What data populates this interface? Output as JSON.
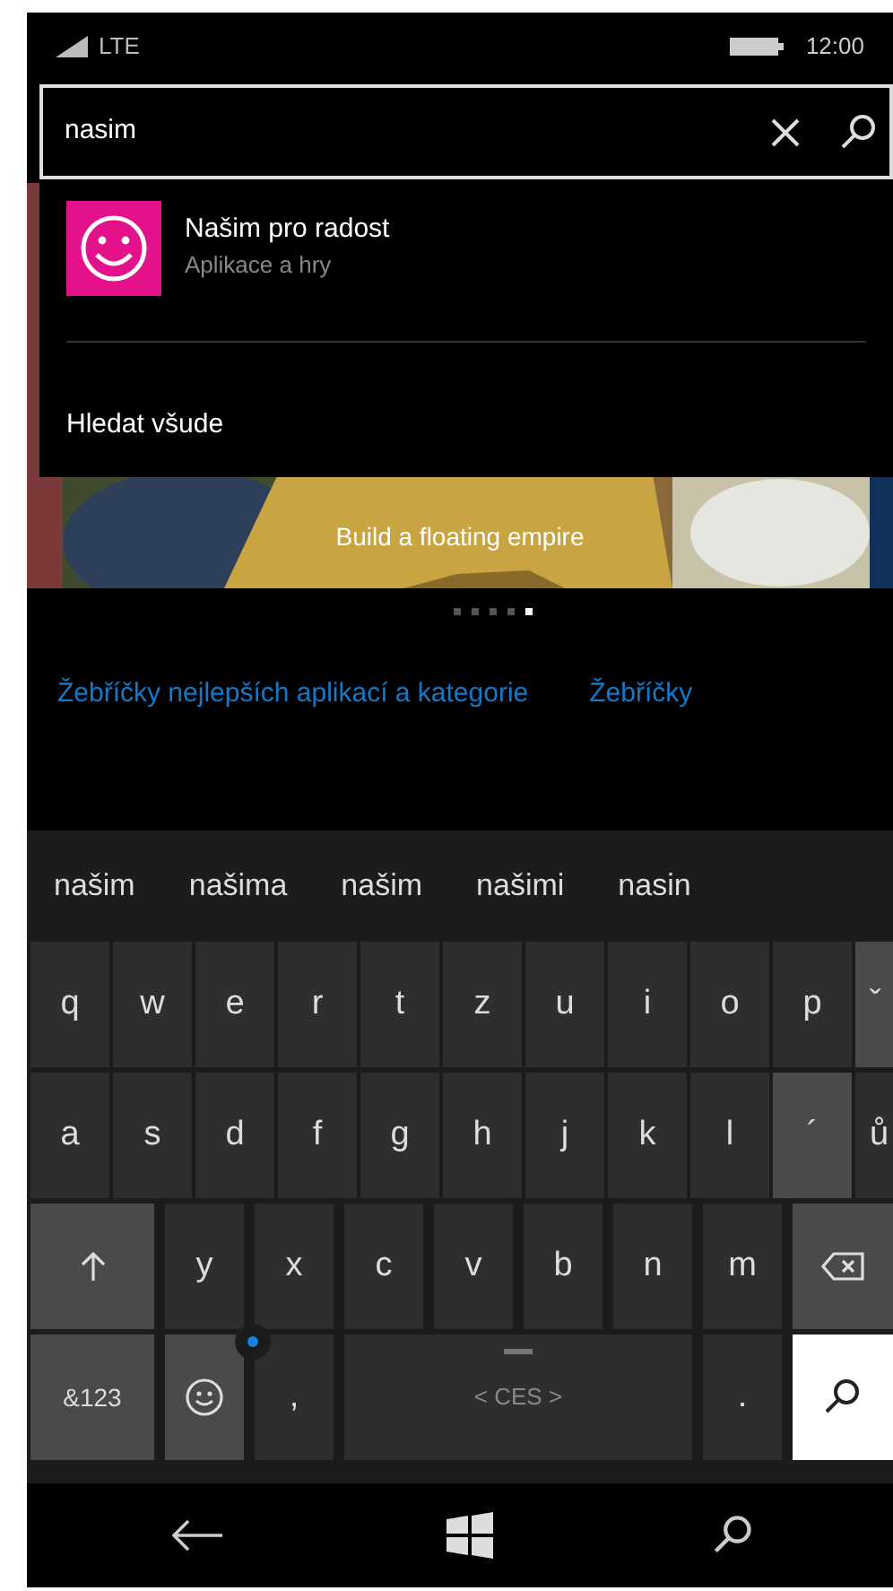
{
  "status_bar": {
    "network": "LTE",
    "time": "12:00"
  },
  "search": {
    "value": "nasim"
  },
  "suggestions": [
    {
      "title": "Našim pro radost",
      "subtitle": "Aplikace a hry"
    }
  ],
  "search_everywhere": "Hledat všude",
  "banner": {
    "caption": "Build a floating empire"
  },
  "pager": [
    {
      "selected": false
    },
    {
      "selected": false
    },
    {
      "selected": false
    },
    {
      "selected": false
    },
    {
      "selected": true
    }
  ],
  "links": [
    "Žebříčky nejlepších aplikací a kategorie",
    "Žebříčky"
  ],
  "keyboard": {
    "predictions": [
      "našim",
      "našima",
      "našim",
      "našimi",
      "nasin"
    ],
    "rows": [
      {
        "keys": [
          {
            "kind": "letter",
            "label": "q"
          },
          {
            "kind": "letter",
            "label": "w"
          },
          {
            "kind": "letter",
            "label": "e"
          },
          {
            "kind": "letter",
            "label": "r"
          },
          {
            "kind": "letter",
            "label": "t"
          },
          {
            "kind": "letter",
            "label": "z"
          },
          {
            "kind": "letter",
            "label": "u"
          },
          {
            "kind": "letter",
            "label": "i"
          },
          {
            "kind": "letter",
            "label": "o"
          },
          {
            "kind": "letter",
            "label": "p"
          },
          {
            "kind": "accent",
            "label": "ˇ"
          }
        ]
      },
      {
        "keys": [
          {
            "kind": "letter",
            "label": "a"
          },
          {
            "kind": "letter",
            "label": "s"
          },
          {
            "kind": "letter",
            "label": "d"
          },
          {
            "kind": "letter",
            "label": "f"
          },
          {
            "kind": "letter",
            "label": "g"
          },
          {
            "kind": "letter",
            "label": "h"
          },
          {
            "kind": "letter",
            "label": "j"
          },
          {
            "kind": "letter",
            "label": "k"
          },
          {
            "kind": "letter",
            "label": "l"
          },
          {
            "kind": "accent",
            "label": "´"
          },
          {
            "kind": "letter",
            "label": "ů"
          }
        ]
      },
      {
        "keys": [
          {
            "kind": "shift"
          },
          {
            "kind": "letter",
            "label": "y"
          },
          {
            "kind": "letter",
            "label": "x"
          },
          {
            "kind": "letter",
            "label": "c"
          },
          {
            "kind": "letter",
            "label": "v"
          },
          {
            "kind": "letter",
            "label": "b"
          },
          {
            "kind": "letter",
            "label": "n"
          },
          {
            "kind": "letter",
            "label": "m"
          },
          {
            "kind": "backspace"
          }
        ]
      },
      {
        "keys": [
          {
            "kind": "symbols",
            "label": "&123"
          },
          {
            "kind": "emoji"
          },
          {
            "kind": "letter",
            "label": ","
          },
          {
            "kind": "space",
            "label": "< CES >"
          },
          {
            "kind": "letter",
            "label": "."
          },
          {
            "kind": "search"
          }
        ]
      }
    ]
  }
}
